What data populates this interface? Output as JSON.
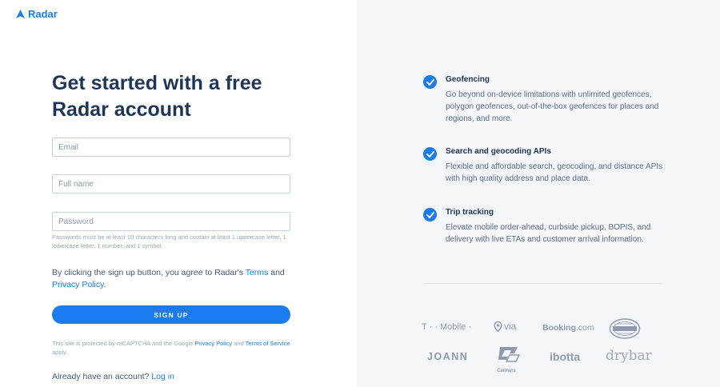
{
  "brand": {
    "name": "Radar",
    "accent": "#1a7ce8"
  },
  "headline": "Get started with a free Radar account",
  "form": {
    "email_placeholder": "Email",
    "name_placeholder": "Full name",
    "password_placeholder": "Password",
    "password_hint": "Passwords must be at least 10 characters long and contain at least 1 uppercase letter, 1 lowercase letter, 1 number, and 1 symbol.",
    "terms_prefix": "By clicking the sign up button, you agree to Radar's ",
    "terms_link": "Terms",
    "terms_and": " and ",
    "privacy_link": "Privacy Policy",
    "terms_suffix": ".",
    "signup_label": "SIGN UP",
    "recaptcha_prefix": "This site is protected by reCAPTCHA and the Google ",
    "recaptcha_privacy": "Privacy Policy",
    "recaptcha_and": " and ",
    "recaptcha_terms": "Terms of Service",
    "recaptcha_suffix": " apply.",
    "login_prefix": "Already have an account? ",
    "login_link": "Log in"
  },
  "features": [
    {
      "title": "Geofencing",
      "description": "Go beyond on-device limitations with unlimited geofences, polygon geofences, out-of-the-box geofences for places and regions, and more."
    },
    {
      "title": "Search and geocoding APIs",
      "description": "Flexible and affordable search, geocoding, and distance APIs with high quality address and place data."
    },
    {
      "title": "Trip tracking",
      "description": "Elevate mobile order-ahead, curbside pickup, BOPIS, and delivery with live ETAs and customer arrival information."
    }
  ],
  "logos": {
    "tmobile": "T · · Mobile ·",
    "via": "via",
    "booking_main": "Booking",
    "booking_tld": ".com",
    "joann": "JOANN",
    "caltrans": "Caltrans",
    "ibotta": "ibotta",
    "drybar": "drybar"
  }
}
